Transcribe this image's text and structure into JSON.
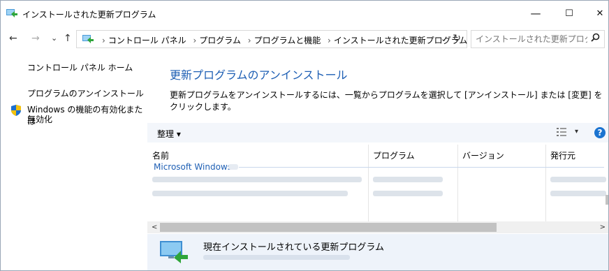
{
  "window": {
    "title": "インストールされた更新プログラム",
    "minimize_glyph": "—",
    "maximize_glyph": "☐",
    "close_glyph": "✕"
  },
  "nav": {
    "back_glyph": "←",
    "forward_glyph": "→",
    "recent_glyph": "⌄",
    "up_glyph": "↑"
  },
  "address": {
    "crumbs": [
      "コントロール パネル",
      "プログラム",
      "プログラムと機能",
      "インストールされた更新プログラム"
    ],
    "separator": "›",
    "dropdown_glyph": "⌄",
    "refresh_glyph": "↻"
  },
  "search": {
    "placeholder": "インストールされた更新プログラムの...",
    "icon": "search-icon"
  },
  "sidebar": {
    "home": "コントロール パネル ホーム",
    "uninstall": "プログラムのアンインストール",
    "features_line1": "Windows の機能の有効化または",
    "features_line2": "無効化"
  },
  "main": {
    "heading": "更新プログラムのアンインストール",
    "description": "更新プログラムをアンインストールするには、一覧からプログラムを選択して [アンインストール] または [変更] をクリックします。"
  },
  "toolbar": {
    "organize": "整理",
    "organize_caret": "▾",
    "view_icon": "view-options-icon",
    "view_caret": "▾",
    "help": "?"
  },
  "table": {
    "columns": [
      "名前",
      "プログラム",
      "バージョン",
      "発行元"
    ],
    "group": "Microsoft Windows"
  },
  "scrollbar": {
    "left_glyph": "<",
    "right_glyph": ">"
  },
  "details": {
    "title": "現在インストールされている更新プログラム"
  },
  "colors": {
    "accent": "#1e5fb4",
    "toolbar_bg": "#f3f6fb",
    "details_bg": "#eef3fa"
  }
}
